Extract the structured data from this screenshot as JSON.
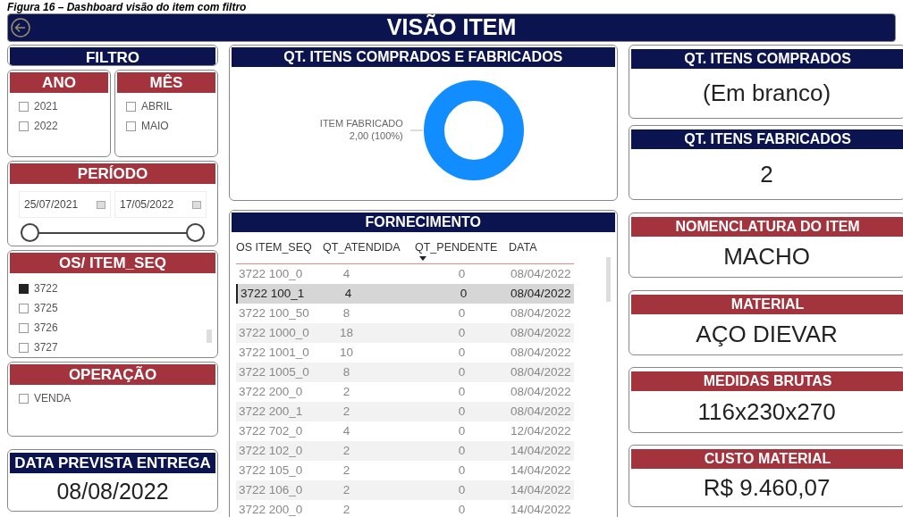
{
  "caption": "Figura 16 – Dashboard visão do item com filtro",
  "header": {
    "title": "VISÃO ITEM"
  },
  "filter": {
    "title": "FILTRO"
  },
  "year_slicer": {
    "title": "ANO",
    "items": [
      {
        "label": "2021",
        "checked": false
      },
      {
        "label": "2022",
        "checked": false
      }
    ]
  },
  "month_slicer": {
    "title": "MÊS",
    "items": [
      {
        "label": "ABRIL",
        "checked": false
      },
      {
        "label": "MAIO",
        "checked": false
      }
    ]
  },
  "period": {
    "title": "PERÍODO",
    "start": "25/07/2021",
    "end": "17/05/2022",
    "handles": [
      {
        "level": 0
      },
      {
        "level": 1
      }
    ]
  },
  "os_slicer": {
    "title": "OS/ ITEM_SEQ",
    "items": [
      {
        "label": "3722",
        "checked": true
      },
      {
        "label": "3725",
        "checked": false
      },
      {
        "label": "3726",
        "checked": false
      },
      {
        "label": "3727",
        "checked": false
      }
    ]
  },
  "operation_slicer": {
    "title": "OPERAÇÃO",
    "items": [
      {
        "label": "VENDA",
        "checked": false
      }
    ]
  },
  "delivery": {
    "title": "DATA PREVISTA ENTREGA",
    "value": "08/08/2022"
  },
  "donut_card": {
    "title": "QT. ITENS COMPRADOS E FABRICADOS",
    "labels": [
      "ITEM FABRICADO",
      "2,00 (100%)"
    ]
  },
  "supply": {
    "title": "FORNECIMENTO",
    "columns": [
      {
        "label": "OS ITEM_SEQ",
        "sorted": false
      },
      {
        "label": "QT_ATENDIDA",
        "sorted": false
      },
      {
        "label": "QT_PENDENTE",
        "sorted": true
      },
      {
        "label": "DATA",
        "sorted": false
      }
    ],
    "rows": [
      {
        "cells": [
          "3722 100_0",
          "4",
          "0",
          "08/04/2022"
        ],
        "selected": false
      },
      {
        "cells": [
          "3722 100_1",
          "4",
          "0",
          "08/04/2022"
        ],
        "selected": true
      },
      {
        "cells": [
          "3722 100_50",
          "8",
          "0",
          "08/04/2022"
        ],
        "selected": false
      },
      {
        "cells": [
          "3722 1000_0",
          "18",
          "0",
          "08/04/2022"
        ],
        "selected": false
      },
      {
        "cells": [
          "3722 1001_0",
          "10",
          "0",
          "08/04/2022"
        ],
        "selected": false
      },
      {
        "cells": [
          "3722 1005_0",
          "8",
          "0",
          "08/04/2022"
        ],
        "selected": false
      },
      {
        "cells": [
          "3722 200_0",
          "2",
          "0",
          "08/04/2022"
        ],
        "selected": false
      },
      {
        "cells": [
          "3722 200_1",
          "2",
          "0",
          "08/04/2022"
        ],
        "selected": false
      },
      {
        "cells": [
          "3722 702_0",
          "4",
          "0",
          "12/04/2022"
        ],
        "selected": false
      },
      {
        "cells": [
          "3722 102_0",
          "2",
          "0",
          "14/04/2022"
        ],
        "selected": false
      },
      {
        "cells": [
          "3722 105_0",
          "2",
          "0",
          "14/04/2022"
        ],
        "selected": false
      },
      {
        "cells": [
          "3722 106_0",
          "2",
          "0",
          "14/04/2022"
        ],
        "selected": false
      },
      {
        "cells": [
          "3722 200_0",
          "2",
          "0",
          "14/04/2022"
        ],
        "selected": false
      }
    ]
  },
  "kpis": [
    {
      "title": "QT. ITENS COMPRADOS",
      "value": "(Em branco)",
      "kind": "navy"
    },
    {
      "title": "QT. ITENS FABRICADOS",
      "value": "2",
      "kind": "navy"
    },
    {
      "title": "NOMENCLATURA DO ITEM",
      "value": "MACHO",
      "kind": "red"
    },
    {
      "title": "MATERIAL",
      "value": "AÇO DIEVAR",
      "kind": "red"
    },
    {
      "title": "MEDIDAS BRUTAS",
      "value": "116x230x270",
      "kind": "red"
    },
    {
      "title": "CUSTO MATERIAL",
      "value": "R$ 9.460,07",
      "kind": "red"
    }
  ]
}
